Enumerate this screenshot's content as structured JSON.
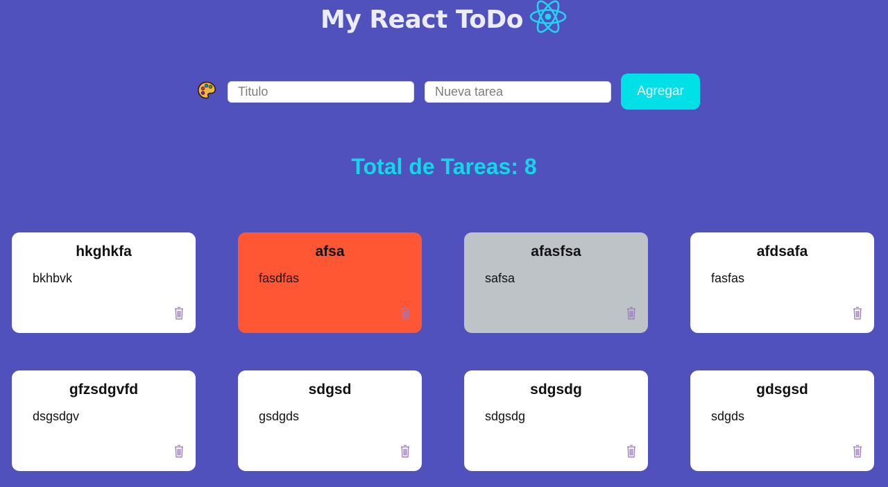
{
  "app": {
    "title": "My React ToDo",
    "logo_icon": "react-atom-icon",
    "accent_color": "#00e0e7",
    "background_color": "#5151bd"
  },
  "form": {
    "color_picker_icon": "palette-icon",
    "title_placeholder": "Titulo",
    "title_value": "",
    "task_placeholder": "Nueva tarea",
    "task_value": "",
    "add_label": "Agregar"
  },
  "summary": {
    "total_text": "Total de Tareas: 8"
  },
  "tasks": [
    {
      "title": "hkghkfa",
      "body": "bkhbvk",
      "color": "#ffffff",
      "delete_icon": "trash-icon"
    },
    {
      "title": "afsa",
      "body": "fasdfas",
      "color": "#ff5733",
      "delete_icon": "trash-icon"
    },
    {
      "title": "afasfsa",
      "body": "safsa",
      "color": "#bec3c8",
      "delete_icon": "trash-icon"
    },
    {
      "title": "afdsafa",
      "body": "fasfas",
      "color": "#ffffff",
      "delete_icon": "trash-icon"
    },
    {
      "title": "gfzsdgvfd",
      "body": "dsgsdgv",
      "color": "#ffffff",
      "delete_icon": "trash-icon"
    },
    {
      "title": "sdgsd",
      "body": "gsdgds",
      "color": "#ffffff",
      "delete_icon": "trash-icon"
    },
    {
      "title": "sdgsdg",
      "body": "sdgsdg",
      "color": "#ffffff",
      "delete_icon": "trash-icon"
    },
    {
      "title": "gdsgsd",
      "body": "sdgds",
      "color": "#ffffff",
      "delete_icon": "trash-icon"
    }
  ]
}
